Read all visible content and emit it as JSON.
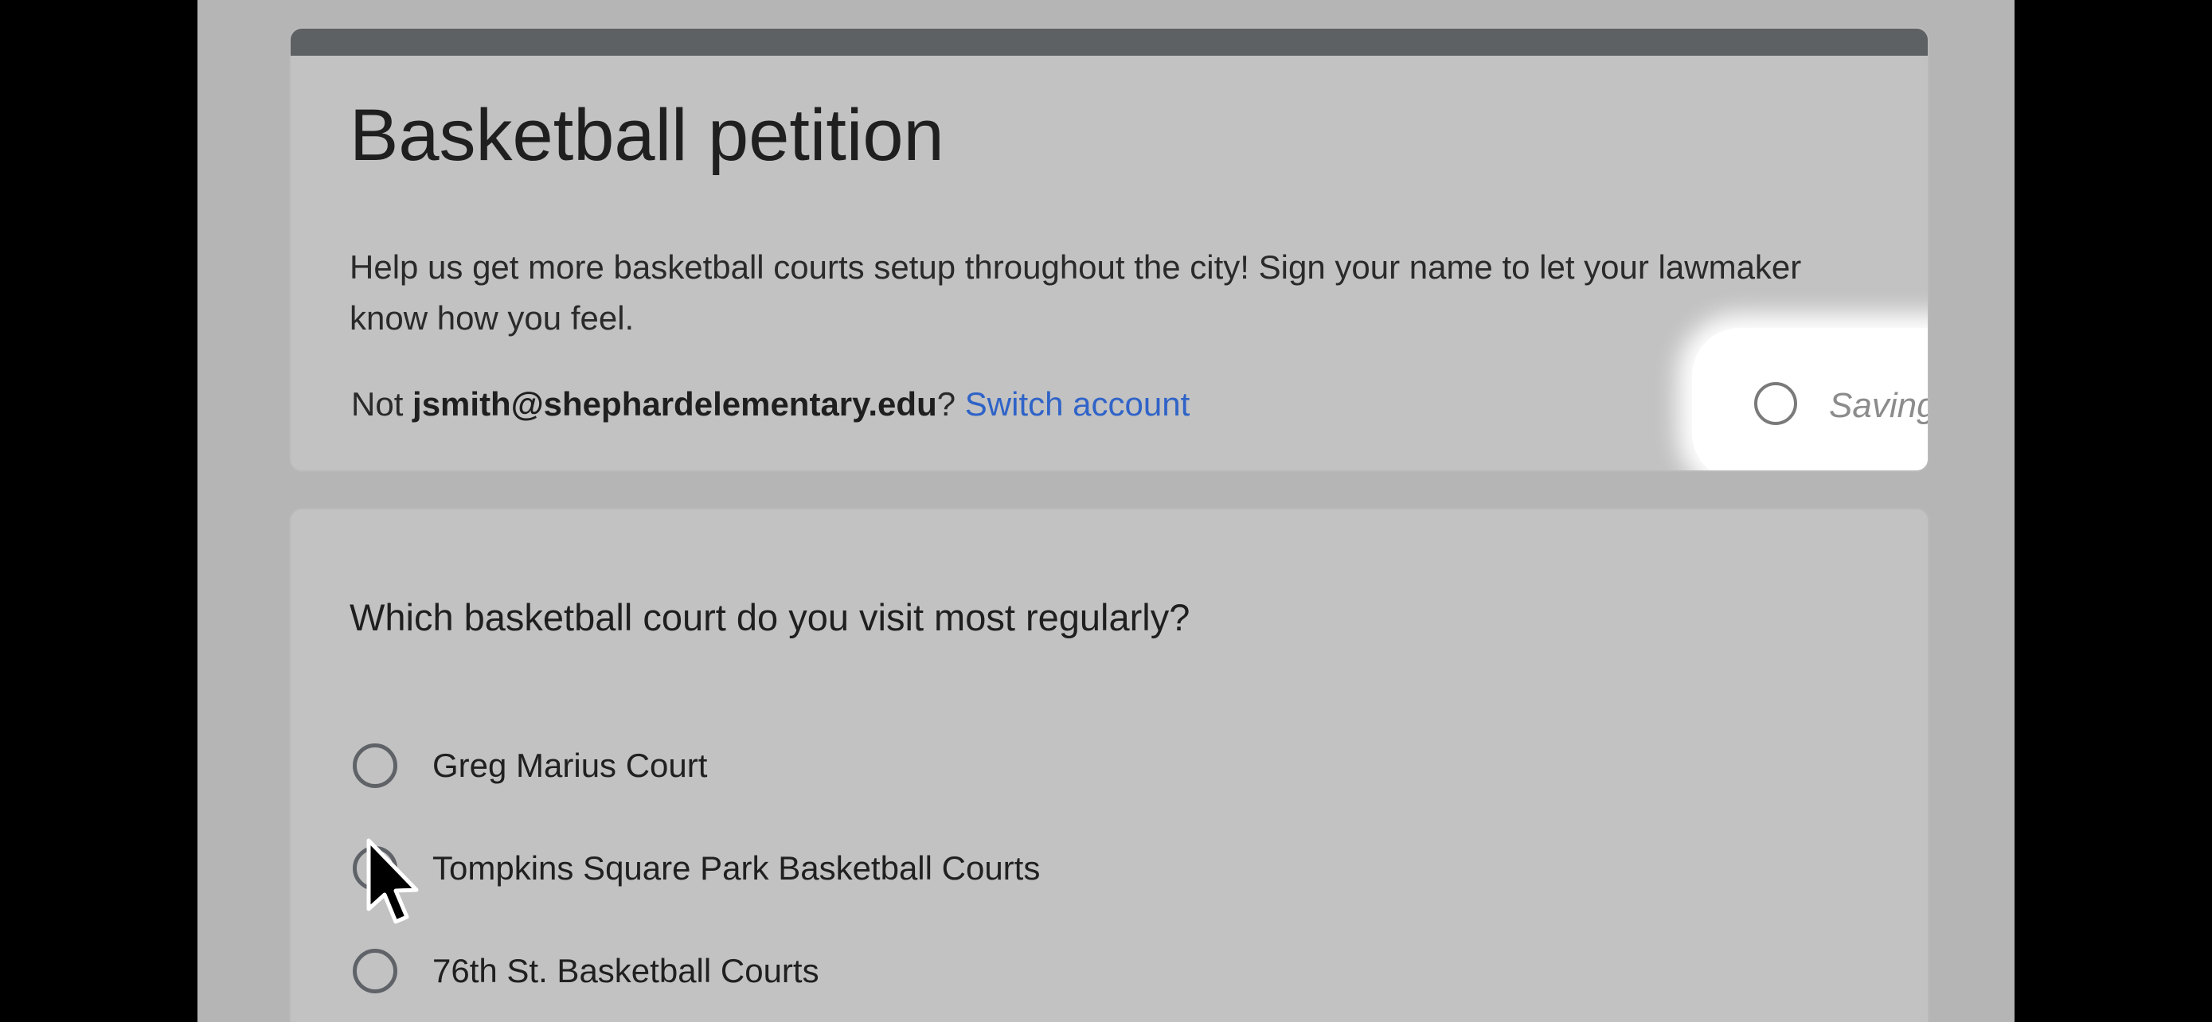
{
  "form": {
    "title": "Basketball petition",
    "description": "Help us get more basketball courts setup throughout the city! Sign your name to let your lawmaker know how you feel.",
    "account": {
      "prefix": "Not ",
      "email": "jsmith@shephardelementary.edu",
      "suffix": "? ",
      "switch_label": "Switch account"
    },
    "status": {
      "label": "Saving...",
      "icon": "loading-spinner-icon"
    },
    "header_color": "#5e6164",
    "link_color": "#2f63c8"
  },
  "question": {
    "text": "Which basketball court do you visit most regularly?",
    "options": [
      {
        "label": "Greg Marius Court"
      },
      {
        "label": "Tompkins Square Park Basketball Courts"
      },
      {
        "label": "76th St. Basketball Courts"
      }
    ]
  },
  "cursor": {
    "icon": "mouse-pointer-icon"
  }
}
